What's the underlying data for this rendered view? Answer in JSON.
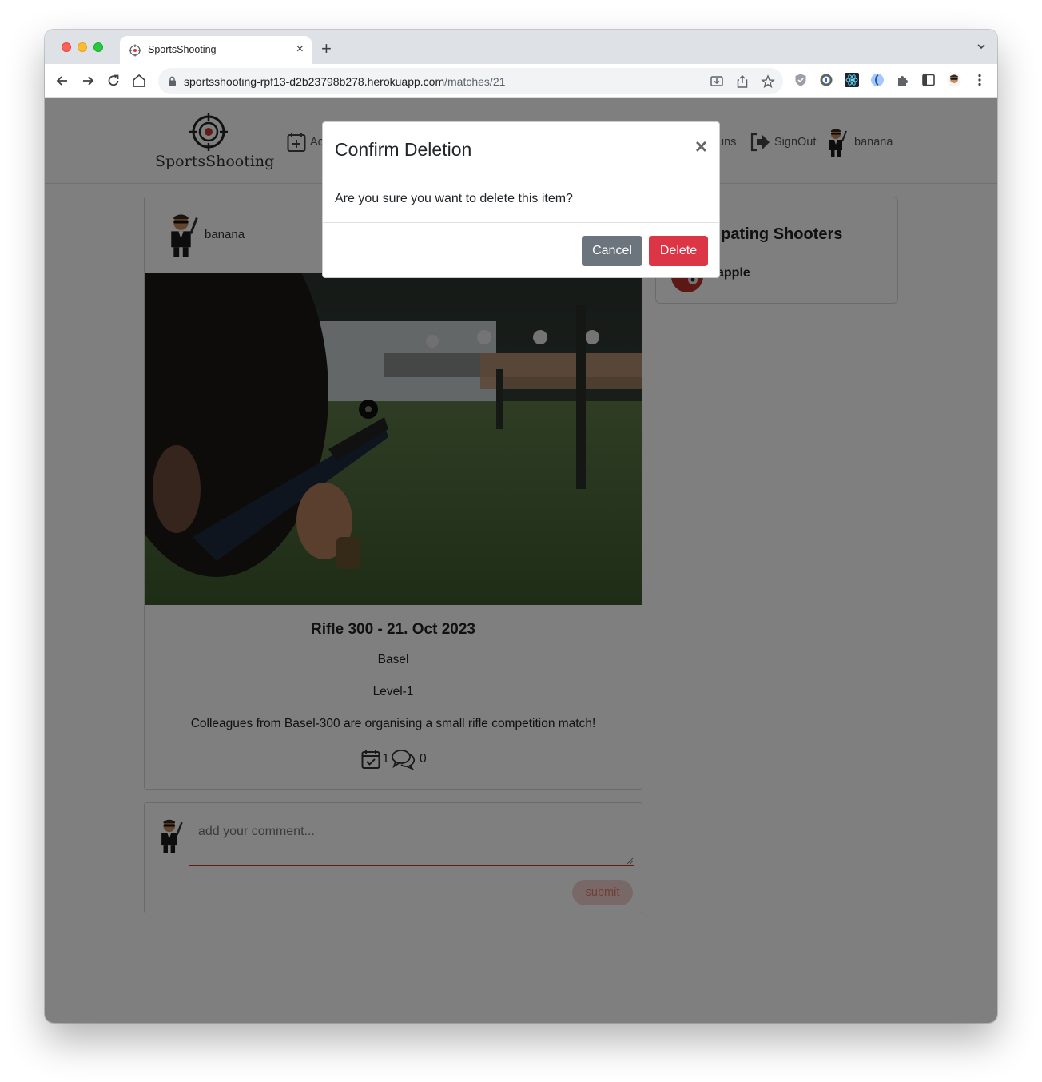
{
  "browser": {
    "tab_title": "SportsShooting",
    "url_domain": "sportsshooting-rpf13-d2b23798b278.herokuapp.com",
    "url_path": "/matches/21"
  },
  "nav": {
    "logo_text": "SportsShooting",
    "add_label": "Ac",
    "guns_label": "uns",
    "signout_label": "SignOut",
    "profile_label": "banana"
  },
  "match": {
    "owner": "banana",
    "title": "Rifle 300 - 21. Oct 2023",
    "location": "Basel",
    "level": "Level-1",
    "description": "Colleagues from Basel-300 are organising a small rifle competition match!",
    "participants_count": "1",
    "comments_count": "0"
  },
  "comment_form": {
    "placeholder": "add your comment...",
    "submit_label": "submit"
  },
  "shooters": {
    "title": "Participating Shooters",
    "items": [
      {
        "name": "apple"
      }
    ]
  },
  "modal": {
    "title": "Confirm Deletion",
    "close_glyph": "×",
    "body": "Are you sure you want to delete this item?",
    "cancel_label": "Cancel",
    "delete_label": "Delete"
  },
  "colors": {
    "danger": "#dc3545",
    "secondary": "#6c757d",
    "brand_red": "#c0392b"
  }
}
